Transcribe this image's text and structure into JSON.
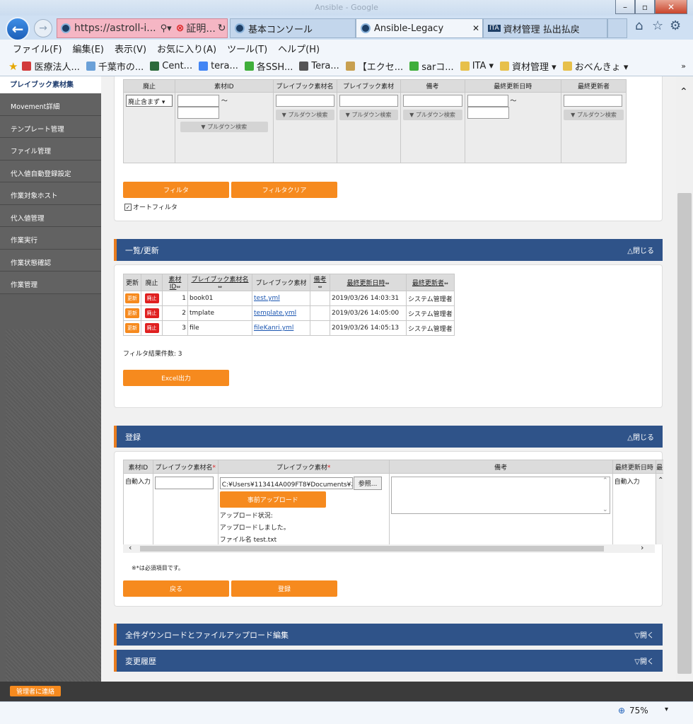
{
  "window": {
    "title": "Ansible - Google"
  },
  "nav": {
    "address": "https://astroll-i...",
    "cert_label": "証明...",
    "tabs": [
      {
        "label": "基本コンソール"
      },
      {
        "label": "Ansible-Legacy"
      },
      {
        "label": "資材管理 払出払戻"
      }
    ]
  },
  "menu": [
    "ファイル(F)",
    "編集(E)",
    "表示(V)",
    "お気に入り(A)",
    "ツール(T)",
    "ヘルプ(H)"
  ],
  "favorites": [
    {
      "label": "医療法人...",
      "color": "#d23b3b"
    },
    {
      "label": "千葉市の...",
      "color": "#6aa0d8"
    },
    {
      "label": "Cent...",
      "color": "#2d6a3a"
    },
    {
      "label": "tera...",
      "color": "#4285f4"
    },
    {
      "label": "各SSH...",
      "color": "#3fae3a"
    },
    {
      "label": "Tera...",
      "color": "#555555"
    },
    {
      "label": "【エクセ...",
      "color": "#c8a050"
    },
    {
      "label": "sarコ...",
      "color": "#3fae3a"
    },
    {
      "label": "ITA ▾",
      "color": "#e7c04a"
    },
    {
      "label": "資材管理 ▾",
      "color": "#e7c04a"
    },
    {
      "label": "おべんきょ ▾",
      "color": "#e7c04a"
    }
  ],
  "sidebar": {
    "current": "プレイブック素材集",
    "items": [
      "Movement詳細",
      "テンプレート管理",
      "ファイル管理",
      "代入値自動登録設定",
      "作業対象ホスト",
      "代入値管理",
      "作業実行",
      "作業状態確認",
      "作業管理"
    ]
  },
  "filter": {
    "headers": [
      "廃止",
      "素材ID",
      "プレイブック素材名",
      "プレイブック素材",
      "備考",
      "最終更新日時",
      "最終更新者"
    ],
    "discard_select": "廃止含まず",
    "pulldown": "▼ プルダウン検索",
    "tilde": "～",
    "filter_button": "フィルタ",
    "clear_button": "フィルタクリア",
    "auto_filter": "オートフィルタ"
  },
  "list_section": {
    "title": "一覧/更新",
    "toggle": "△閉じる",
    "headers": [
      "更新",
      "廃止",
      "素材ID",
      "プレイブック素材名",
      "プレイブック素材",
      "備考",
      "最終更新日時",
      "最終更新者"
    ],
    "sort_mark": "⇔",
    "update_label": "更新",
    "discard_label": "廃止",
    "rows": [
      {
        "id": "1",
        "name": "book01",
        "file": "test.yml",
        "note": "",
        "updated": "2019/03/26 14:03:31",
        "user": "システム管理者"
      },
      {
        "id": "2",
        "name": "tmplate",
        "file": "template.yml",
        "note": "",
        "updated": "2019/03/26 14:05:00",
        "user": "システム管理者"
      },
      {
        "id": "3",
        "name": "file",
        "file": "fileKanri.yml",
        "note": "",
        "updated": "2019/03/26 14:05:13",
        "user": "システム管理者"
      }
    ],
    "result_label": "フィルタ結果件数: 3",
    "excel_button": "Excel出力"
  },
  "register": {
    "title": "登録",
    "toggle": "△閉じる",
    "headers": [
      "素材ID",
      "プレイブック素材名",
      "プレイブック素材",
      "備考",
      "最終更新日時",
      "最"
    ],
    "required_mark": "*",
    "auto_input": "自動入力",
    "file_path": "C:¥Users¥113414A009FT8¥Documents¥お",
    "browse_button": "参照...",
    "preupload_button": "事前アップロード",
    "upload_status_label": "アップロード状況:",
    "upload_status": "アップロードしました。",
    "file_name": "ファイル名 test.txt",
    "required_note": "※*は必須項目です。",
    "back_button": "戻る",
    "register_button": "登録"
  },
  "collapsed": [
    {
      "title": "全件ダウンロードとファイルアップロード編集",
      "toggle": "▽開く"
    },
    {
      "title": "変更履歴",
      "toggle": "▽開く"
    }
  ],
  "footer": {
    "contact_button": "管理者に連絡"
  },
  "status": {
    "zoom": "75%"
  }
}
